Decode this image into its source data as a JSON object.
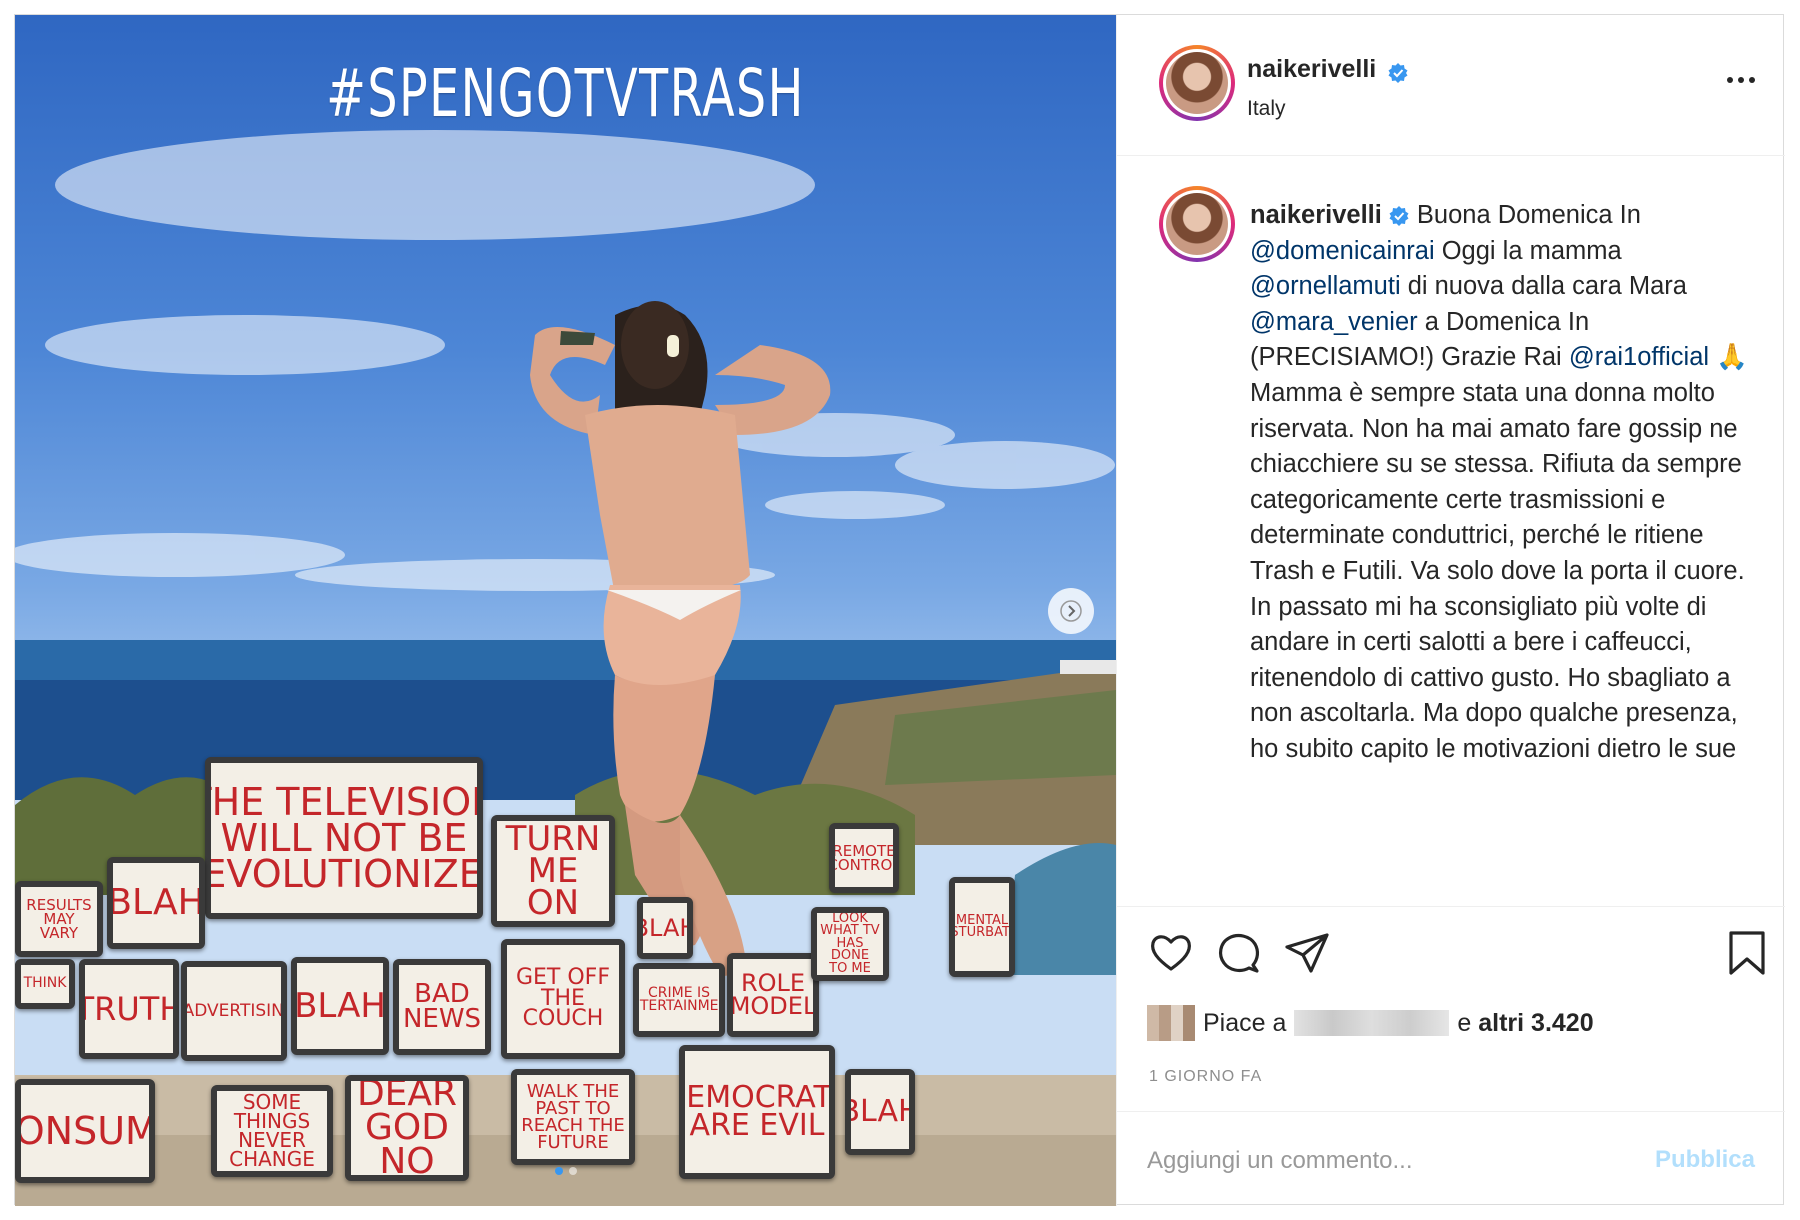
{
  "post": {
    "overlay_hashtag": "#SPENGOTVTRASH",
    "tv_signs": [
      "THE TELEVISION WILL NOT BE REVOLUTIONIZED",
      "TURN ME ON",
      "BLAH",
      "RESULTS MAY VARY",
      "THINK",
      "TRUTH",
      "BADVERTISING",
      "BLAH",
      "BAD NEWS",
      "GET OFF THE COUCH",
      "CRIME IS ENTERTAINMENT",
      "ROLE MODEL",
      "BLAH",
      "CONSUME",
      "SOME THINGS NEVER CHANGE",
      "DEAR GOD NO",
      "WALK THE PAST TO REACH THE FUTURE",
      "DEMOCRATS ARE EVIL",
      "BLAH",
      "REMOTE CONTROL",
      "LOOK WHAT TV HAS DONE TO ME",
      "MENTAL MASTURBATION"
    ]
  },
  "header": {
    "username": "naikerivelli",
    "location": "Italy"
  },
  "caption": {
    "username": "naikerivelli",
    "t1": " Buona Domenica In ",
    "m1": "@domenicainrai",
    "t2": " Oggi la mamma ",
    "m2": "@ornellamuti",
    "t3": " di nuova dalla cara Mara ",
    "m3": "@mara_venier",
    "t4": " a Domenica In (PRECISIAMO!) Grazie Rai ",
    "m4": "@rai1official",
    "emoji": "🙏",
    "t5": " Mamma è sempre stata una donna molto riservata. Non ha mai amato fare gossip ne chiacchiere su se stessa. Rifiuta da sempre categoricamente certe trasmissioni e determinate conduttrici, perché le ritiene Trash e Futili. Va solo dove la porta il cuore. In passato mi ha sconsigliato più volte di andare in certi salotti a bere i caffeucci, ritenendolo di cattivo gusto. Ho sbagliato a non ascoltarla. Ma dopo qualche presenza, ho subito capito le motivazioni dietro le sue"
  },
  "likes": {
    "prefix": "Piace a",
    "suffix": "e",
    "count_text": "altri 3.420"
  },
  "timestamp": "1 GIORNO FA",
  "comment_box": {
    "placeholder": "Aggiungi un commento...",
    "publish_label": "Pubblica"
  },
  "carousel": {
    "current": 1,
    "total": 2
  },
  "colors": {
    "mention": "#003569",
    "publish_disabled": "#b2dffc",
    "verified": "#3897f0",
    "timestamp": "#8e8e8e"
  },
  "icons": [
    "heart-icon",
    "comment-icon",
    "share-icon",
    "bookmark-icon",
    "more-icon",
    "verified-icon",
    "chevron-right-icon"
  ]
}
